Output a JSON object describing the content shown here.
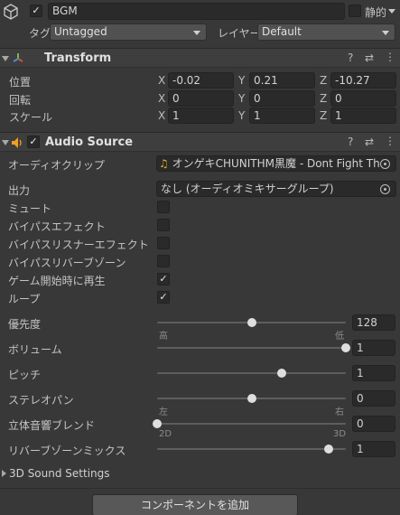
{
  "gameobject": {
    "active": true,
    "name": "BGM",
    "static_label": "静的",
    "static_checked": false,
    "tag_label": "タグ",
    "tag_value": "Untagged",
    "layer_label": "レイヤー",
    "layer_value": "Default"
  },
  "transform": {
    "title": "Transform",
    "position_label": "位置",
    "rotation_label": "回転",
    "scale_label": "スケール",
    "axes": [
      "X",
      "Y",
      "Z"
    ],
    "position": [
      "-0.02",
      "0.21",
      "-10.27"
    ],
    "rotation": [
      "0",
      "0",
      "0"
    ],
    "scale": [
      "1",
      "1",
      "1"
    ]
  },
  "audio_source": {
    "title": "Audio Source",
    "enabled": true,
    "clip_label": "オーディオクリップ",
    "clip_value": "オンゲキCHUNITHM黒魔 - Dont Fight The",
    "output_label": "出力",
    "output_value": "なし (オーディオミキサーグループ)",
    "toggles": [
      {
        "label": "ミュート",
        "checked": false
      },
      {
        "label": "バイパスエフェクト",
        "checked": false
      },
      {
        "label": "バイパスリスナーエフェクト",
        "checked": false
      },
      {
        "label": "バイパスリバーブゾーン",
        "checked": false
      },
      {
        "label": "ゲーム開始時に再生",
        "checked": true
      },
      {
        "label": "ループ",
        "checked": true
      }
    ],
    "priority": {
      "label": "優先度",
      "value": "128",
      "level": 0.5,
      "left_tick": "高",
      "right_tick": "低"
    },
    "volume": {
      "label": "ボリューム",
      "value": "1",
      "level": 1.0
    },
    "pitch": {
      "label": "ピッチ",
      "value": "1",
      "level": 0.66
    },
    "stereo_pan": {
      "label": "ステレオパン",
      "value": "0",
      "level": 0.5,
      "left_tick": "左",
      "right_tick": "右"
    },
    "spatial_blend": {
      "label": "立体音響ブレンド",
      "value": "0",
      "level": 0.0,
      "left_tick": "2D",
      "right_tick": "3D"
    },
    "reverb_zone_mix": {
      "label": "リバーブゾーンミックス",
      "value": "1",
      "level": 0.91
    },
    "sound_settings_label": "3D Sound Settings"
  },
  "add_component_label": "コンポーネントを追加",
  "colors": {
    "background": "#383838",
    "header": "#3e3e3e",
    "field": "#2a2a2a",
    "audio_icon": "#f0a020"
  }
}
